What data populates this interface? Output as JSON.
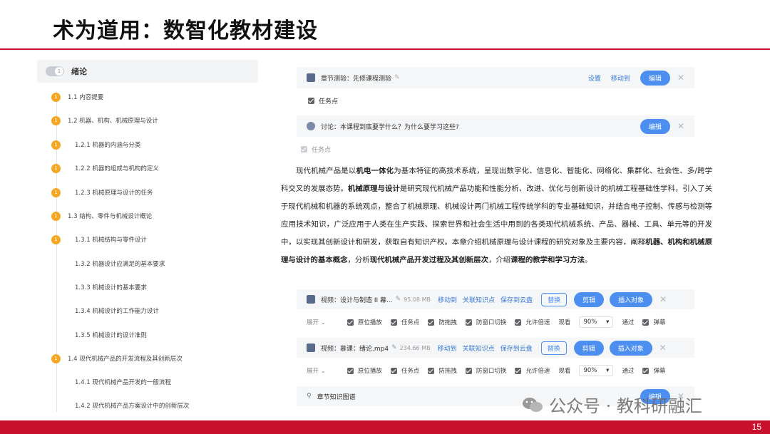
{
  "slide": {
    "title": "术为道用：数智化教材建设",
    "page_number": "15"
  },
  "toc": {
    "head_label": "绪论",
    "head_badge": "1",
    "items": [
      {
        "dot": "1",
        "label": "1.1 内容提要"
      },
      {
        "dot": "1",
        "label": "1.2 机器、机构、机械原理与设计"
      },
      {
        "dot": "1",
        "label": "1.2.1 机器的内涵与分类"
      },
      {
        "dot": "1",
        "label": "1.2.2 机器的组成与机构的定义"
      },
      {
        "dot": "1",
        "label": "1.2.3 机械原理与设计的任务"
      },
      {
        "dot": "1",
        "label": "1.3 结构、零件与机械设计概论"
      },
      {
        "dot": "1",
        "label": "1.3.1 机械结构与零件设计"
      },
      {
        "dot": "",
        "label": "1.3.2 机器设计应满足的基本要求"
      },
      {
        "dot": "",
        "label": "1.3.3 机械设计的基本要求"
      },
      {
        "dot": "",
        "label": "1.3.4 机械设计的工作能力设计"
      },
      {
        "dot": "",
        "label": "1.3.5 机械设计的设计准则"
      },
      {
        "dot": "1",
        "label": "1.4 现代机械产品的开发流程及其创新层次"
      },
      {
        "dot": "",
        "label": "1.4.1 现代机械产品开发的一般流程"
      },
      {
        "dot": "",
        "label": "1.4.2 现代机械产品方案设计中的创新层次"
      }
    ]
  },
  "quiz_card": {
    "title": "章节测验：先修课程测验",
    "settings": "设置",
    "move": "移动到",
    "edit": "编辑",
    "task_point": "任务点"
  },
  "discussion_card": {
    "title": "讨论：本课程到底要学什么？为什么要学习这些?",
    "edit": "编辑",
    "task_point": "任务点"
  },
  "paragraph": {
    "p1": "现代机械产品是以",
    "b1": "机电一体化",
    "p2": "为基本特征的高技术系统，呈现出数字化、信息化、智能化、网络化、集群化、社会性、多/跨学科交叉的发展态势。",
    "b2": "机械原理与设计",
    "p3": "是研究现代机械产品功能和性能分析、改进、优化与创新设计的机械工程基础性学科，引入了关于现代机械和机器的系统观点，整合了机械原理、机械设计两门机械工程传统学科的专业基础知识，并结合电子控制、传感与检测等应用技术知识，广泛应用于人类在生产实践、探索世界和社会生活中用到的各类现代机械系统、产品、器械、工具、单元等的开发中，以实现其创新设计和研发，获取自有知识产权。本章介绍机械原理与设计课程的研究对象及主要内容，阐释",
    "b3": "机器、机构和机械原理与设计的基本概念",
    "p4": "，分析",
    "b4": "现代机械产品开发过程及其创新层次",
    "p5": "，介绍",
    "b5": "课程的教学和学习方法",
    "p6": "。"
  },
  "video1": {
    "title": "视频：设计与制造 II 幕...",
    "size": "95.08 MB",
    "move": "移动到",
    "link_kp": "关联知识点",
    "save_cloud": "保存到云盘",
    "replace": "替换",
    "clip": "剪辑",
    "insert": "插入对象",
    "expand": "展开",
    "opts": [
      "原位播放",
      "任务点",
      "防拖拽",
      "防窗口切换",
      "允许倍速"
    ],
    "watch_label": "观看",
    "watch_value": "90%",
    "pass_label": "通过",
    "danmu": "弹幕"
  },
  "video2": {
    "title": "视频：慕课：绪论.mp4",
    "size": "234.66 MB",
    "move": "移动到",
    "link_kp": "关联知识点",
    "save_cloud": "保存到云盘",
    "replace": "替换",
    "clip": "剪辑",
    "insert": "插入对象",
    "expand": "展开",
    "opts": [
      "原位播放",
      "任务点",
      "防拖拽",
      "防窗口切换",
      "允许倍速"
    ],
    "watch_label": "观看",
    "watch_value": "90%",
    "pass_label": "通过",
    "danmu": "弹幕"
  },
  "knowledge_graph": {
    "title": "章节知识图谱",
    "edit": "编辑"
  },
  "watermark": {
    "text": "公众号 · 教科研融汇"
  },
  "colors": {
    "brand_red": "#c8102e",
    "accent_blue": "#4d8ff0",
    "toc_dot": "#f5a623"
  }
}
